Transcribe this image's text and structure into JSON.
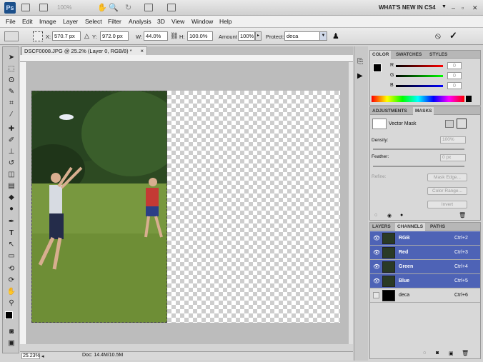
{
  "appbar": {
    "logo": "Ps",
    "zoom": "100%",
    "whats_new": "WHAT'S NEW IN CS4"
  },
  "menu": [
    "File",
    "Edit",
    "Image",
    "Layer",
    "Select",
    "Filter",
    "Analysis",
    "3D",
    "View",
    "Window",
    "Help"
  ],
  "options": {
    "x_label": "X:",
    "x_value": "570.7 px",
    "y_label": "Y:",
    "y_value": "972.0 px",
    "w_label": "W:",
    "w_value": "44.0%",
    "h_label": "H:",
    "h_value": "100.0%",
    "amount_label": "Amount",
    "amount_value": "100%",
    "protect_label": "Protect:",
    "protect_value": "deca"
  },
  "document": {
    "tab_title": "DSCF0008.JPG @ 25.2% (Layer 0, RGB/8) *",
    "close": "×"
  },
  "status": {
    "zoom": "25.23%",
    "doc": "Doc: 14.4M/10.5M"
  },
  "color_panel": {
    "tabs": [
      "COLOR",
      "SWATCHES",
      "STYLES"
    ],
    "r_label": "R",
    "r_value": "0",
    "g_label": "G",
    "g_value": "0",
    "b_label": "B",
    "b_value": "0"
  },
  "masks_panel": {
    "tabs": [
      "ADJUSTMENTS",
      "MASKS"
    ],
    "mask_type": "Vector Mask",
    "density_label": "Density:",
    "density_value": "100%",
    "feather_label": "Feather:",
    "feather_value": "0 px",
    "refine_label": "Refine:",
    "mask_edge_btn": "Mask Edge...",
    "color_range_btn": "Color Range...",
    "invert_btn": "Invert"
  },
  "channels_panel": {
    "tabs": [
      "LAYERS",
      "CHANNELS",
      "PATHS"
    ],
    "channels": [
      {
        "name": "RGB",
        "shortcut": "Ctrl+2",
        "selected": true,
        "visible": true
      },
      {
        "name": "Red",
        "shortcut": "Ctrl+3",
        "selected": true,
        "visible": true
      },
      {
        "name": "Green",
        "shortcut": "Ctrl+4",
        "selected": true,
        "visible": true
      },
      {
        "name": "Blue",
        "shortcut": "Ctrl+5",
        "selected": true,
        "visible": true
      },
      {
        "name": "deca",
        "shortcut": "Ctrl+6",
        "selected": false,
        "visible": false
      }
    ]
  },
  "colors": {
    "accent": "#4e63b6",
    "app_bg": "#d4d4d4"
  }
}
